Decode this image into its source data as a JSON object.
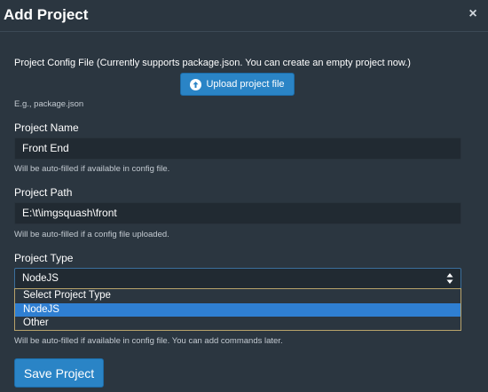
{
  "dialog": {
    "title": "Add Project",
    "close_glyph": "×"
  },
  "config": {
    "label": "Project Config File (Currently supports package.json. You can create an empty project now.)",
    "upload_label": "Upload project file",
    "upload_icon": "upload-circle-icon",
    "hint": "E.g., package.json"
  },
  "name": {
    "label": "Project Name",
    "value": "Front End",
    "help": "Will be auto-filled if available in config file."
  },
  "path": {
    "label": "Project Path",
    "value": "E:\\t\\imgsquash\\front",
    "help": "Will be auto-filled if a config file uploaded."
  },
  "type": {
    "label": "Project Type",
    "selected": "NodeJS",
    "options": [
      "Select Project Type",
      "NodeJS",
      "Other"
    ],
    "help": "Will be auto-filled if available in config file. You can add commands later."
  },
  "actions": {
    "save_label": "Save Project"
  },
  "colors": {
    "background": "#2b3640",
    "accent": "#2a84c6",
    "selected_option": "#2f7fd2"
  }
}
